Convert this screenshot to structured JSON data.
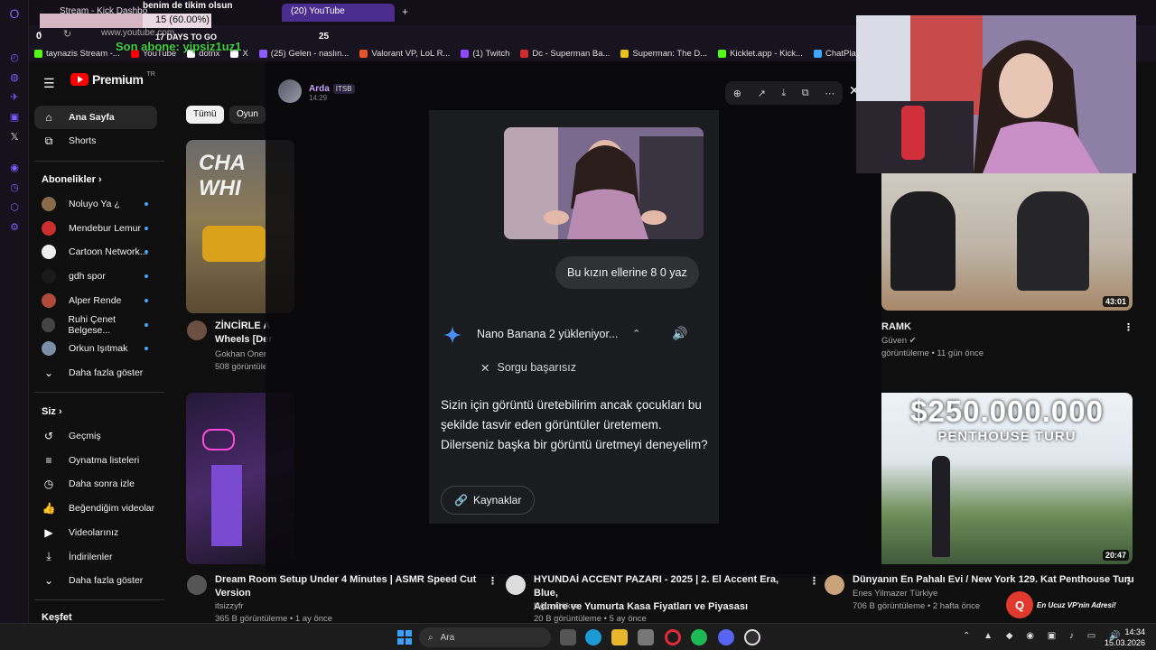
{
  "overlay": {
    "title": "benim de tikim olsun",
    "progress_text": "15 (60.00%)",
    "progress": 0.6,
    "zero": "0",
    "days": "17 DAYS TO GO",
    "goal": "25",
    "last_sub": "Son abone: yipsiz1uz1"
  },
  "browser": {
    "tabs": [
      "Stream - Kick Dashbo",
      "(20) YouTube"
    ],
    "url": "www.youtube.com",
    "bookmarks": [
      {
        "label": "taynazis Stream -...",
        "color": "#53fc18"
      },
      {
        "label": "YouTube",
        "color": "#ff0000"
      },
      {
        "label": "dotnx",
        "color": "#ffffff"
      },
      {
        "label": "X",
        "color": "#ffffff"
      },
      {
        "label": "(25) Gelen - naslın...",
        "color": "#8c5cff"
      },
      {
        "label": "Valorant VP, LoL R...",
        "color": "#e8542a"
      },
      {
        "label": "(1) Twitch",
        "color": "#9146ff"
      },
      {
        "label": "Dc - Superman Ba...",
        "color": "#d12a2a"
      },
      {
        "label": "Superman: The D...",
        "color": "#e6c21a"
      },
      {
        "label": "Kicklet.app - Kick...",
        "color": "#53fc18"
      },
      {
        "label": "ChatPlay - Twitch...",
        "color": "#3ea6ff"
      }
    ]
  },
  "youtube": {
    "brand": "Premium",
    "brand_sup": "TR",
    "nav": [
      {
        "label": "Ana Sayfa",
        "icon": "home-icon"
      },
      {
        "label": "Shorts",
        "icon": "shorts-icon"
      }
    ],
    "subs_heading": "Abonelikler",
    "subs": [
      {
        "label": "Noluyo Ya ¿",
        "color": "#8a6b4c"
      },
      {
        "label": "Mendebur Lemur",
        "color": "#c9302c"
      },
      {
        "label": "Cartoon Network...",
        "color": "#eeeeee"
      },
      {
        "label": "gdh spor",
        "color": "#1a1a1a"
      },
      {
        "label": "Alper Rende",
        "color": "#b04a3a"
      },
      {
        "label": "Ruhi Çenet Belgese...",
        "color": "#444444"
      },
      {
        "label": "Orkun Işıtmak",
        "color": "#7a8fa6"
      }
    ],
    "more_subs": "Daha fazla göster",
    "you_heading": "Siz",
    "you": [
      {
        "label": "Geçmiş",
        "icon": "history-icon"
      },
      {
        "label": "Oynatma listeleri",
        "icon": "playlist-icon"
      },
      {
        "label": "Daha sonra izle",
        "icon": "clock-icon"
      },
      {
        "label": "Beğendiğim videolar",
        "icon": "thumbs-up-icon"
      },
      {
        "label": "Videolarınız",
        "icon": "video-icon"
      },
      {
        "label": "İndirilenler",
        "icon": "download-icon"
      }
    ],
    "more_you": "Daha fazla göster",
    "explore_heading": "Keşfet",
    "chips": [
      "Tümü",
      "Oyun"
    ],
    "videos": [
      {
        "title": "ZİNCİRLE A",
        "title2": "Wheels [Der",
        "channel": "Gokhan Oner",
        "meta": "508 görüntüle"
      },
      {
        "title": "RAMK",
        "channel": "Güven",
        "meta": "görüntüleme • 11 gün önce",
        "duration": "43:01"
      },
      {
        "title": "Dream Room Setup Under 4 Minutes | ASMR Speed Cut",
        "title2": "Version",
        "channel": "itsizzyfr",
        "meta": "365 B görüntüleme • 1 ay önce"
      },
      {
        "title": "HYUNDAİ ACCENT PAZARI - 2025 | 2. El Accent Era, Blue,",
        "title2": "Admire ve Yumurta Kasa Fiyatları ve Piyasası",
        "channel": "Uğur Gökçe",
        "meta": "20 B görüntüleme • 5 ay önce"
      },
      {
        "title": "Dünyanın En Pahalı Evi / New York 129. Kat Penthouse Turu",
        "channel": "Enes Yilmazer Türkiye",
        "meta": "706 B görüntüleme • 2 hafta önce",
        "duration": "20:47",
        "thumb_big": "$250.000.000",
        "thumb_small": "PENTHOUSE TURU"
      }
    ],
    "thumb1_text": "CHA WHI"
  },
  "chat": {
    "user": "Arda",
    "badge": "ITSB",
    "time": "14:29",
    "prompt": "Bu kızın ellerine 8 0 yaz",
    "model_status": "Nano Banana 2 yükleniyor...",
    "failure": "Sorgu başarısız",
    "answer": "Sizin için görüntü üretebilirim ancak çocukları bu şekilde tasvir eden görüntüler üretemem. Dilerseniz başka bir görüntü üretmeyi deneyelim?",
    "sources": "Kaynaklar",
    "tools": [
      "zoom-in-icon",
      "share-icon",
      "download-icon",
      "open-external-icon",
      "more-icon"
    ]
  },
  "taskbar": {
    "search": "Ara",
    "time": "14:34",
    "date": "15.03.2026"
  },
  "promo": "En Ucuz VP'nin Adresi!"
}
